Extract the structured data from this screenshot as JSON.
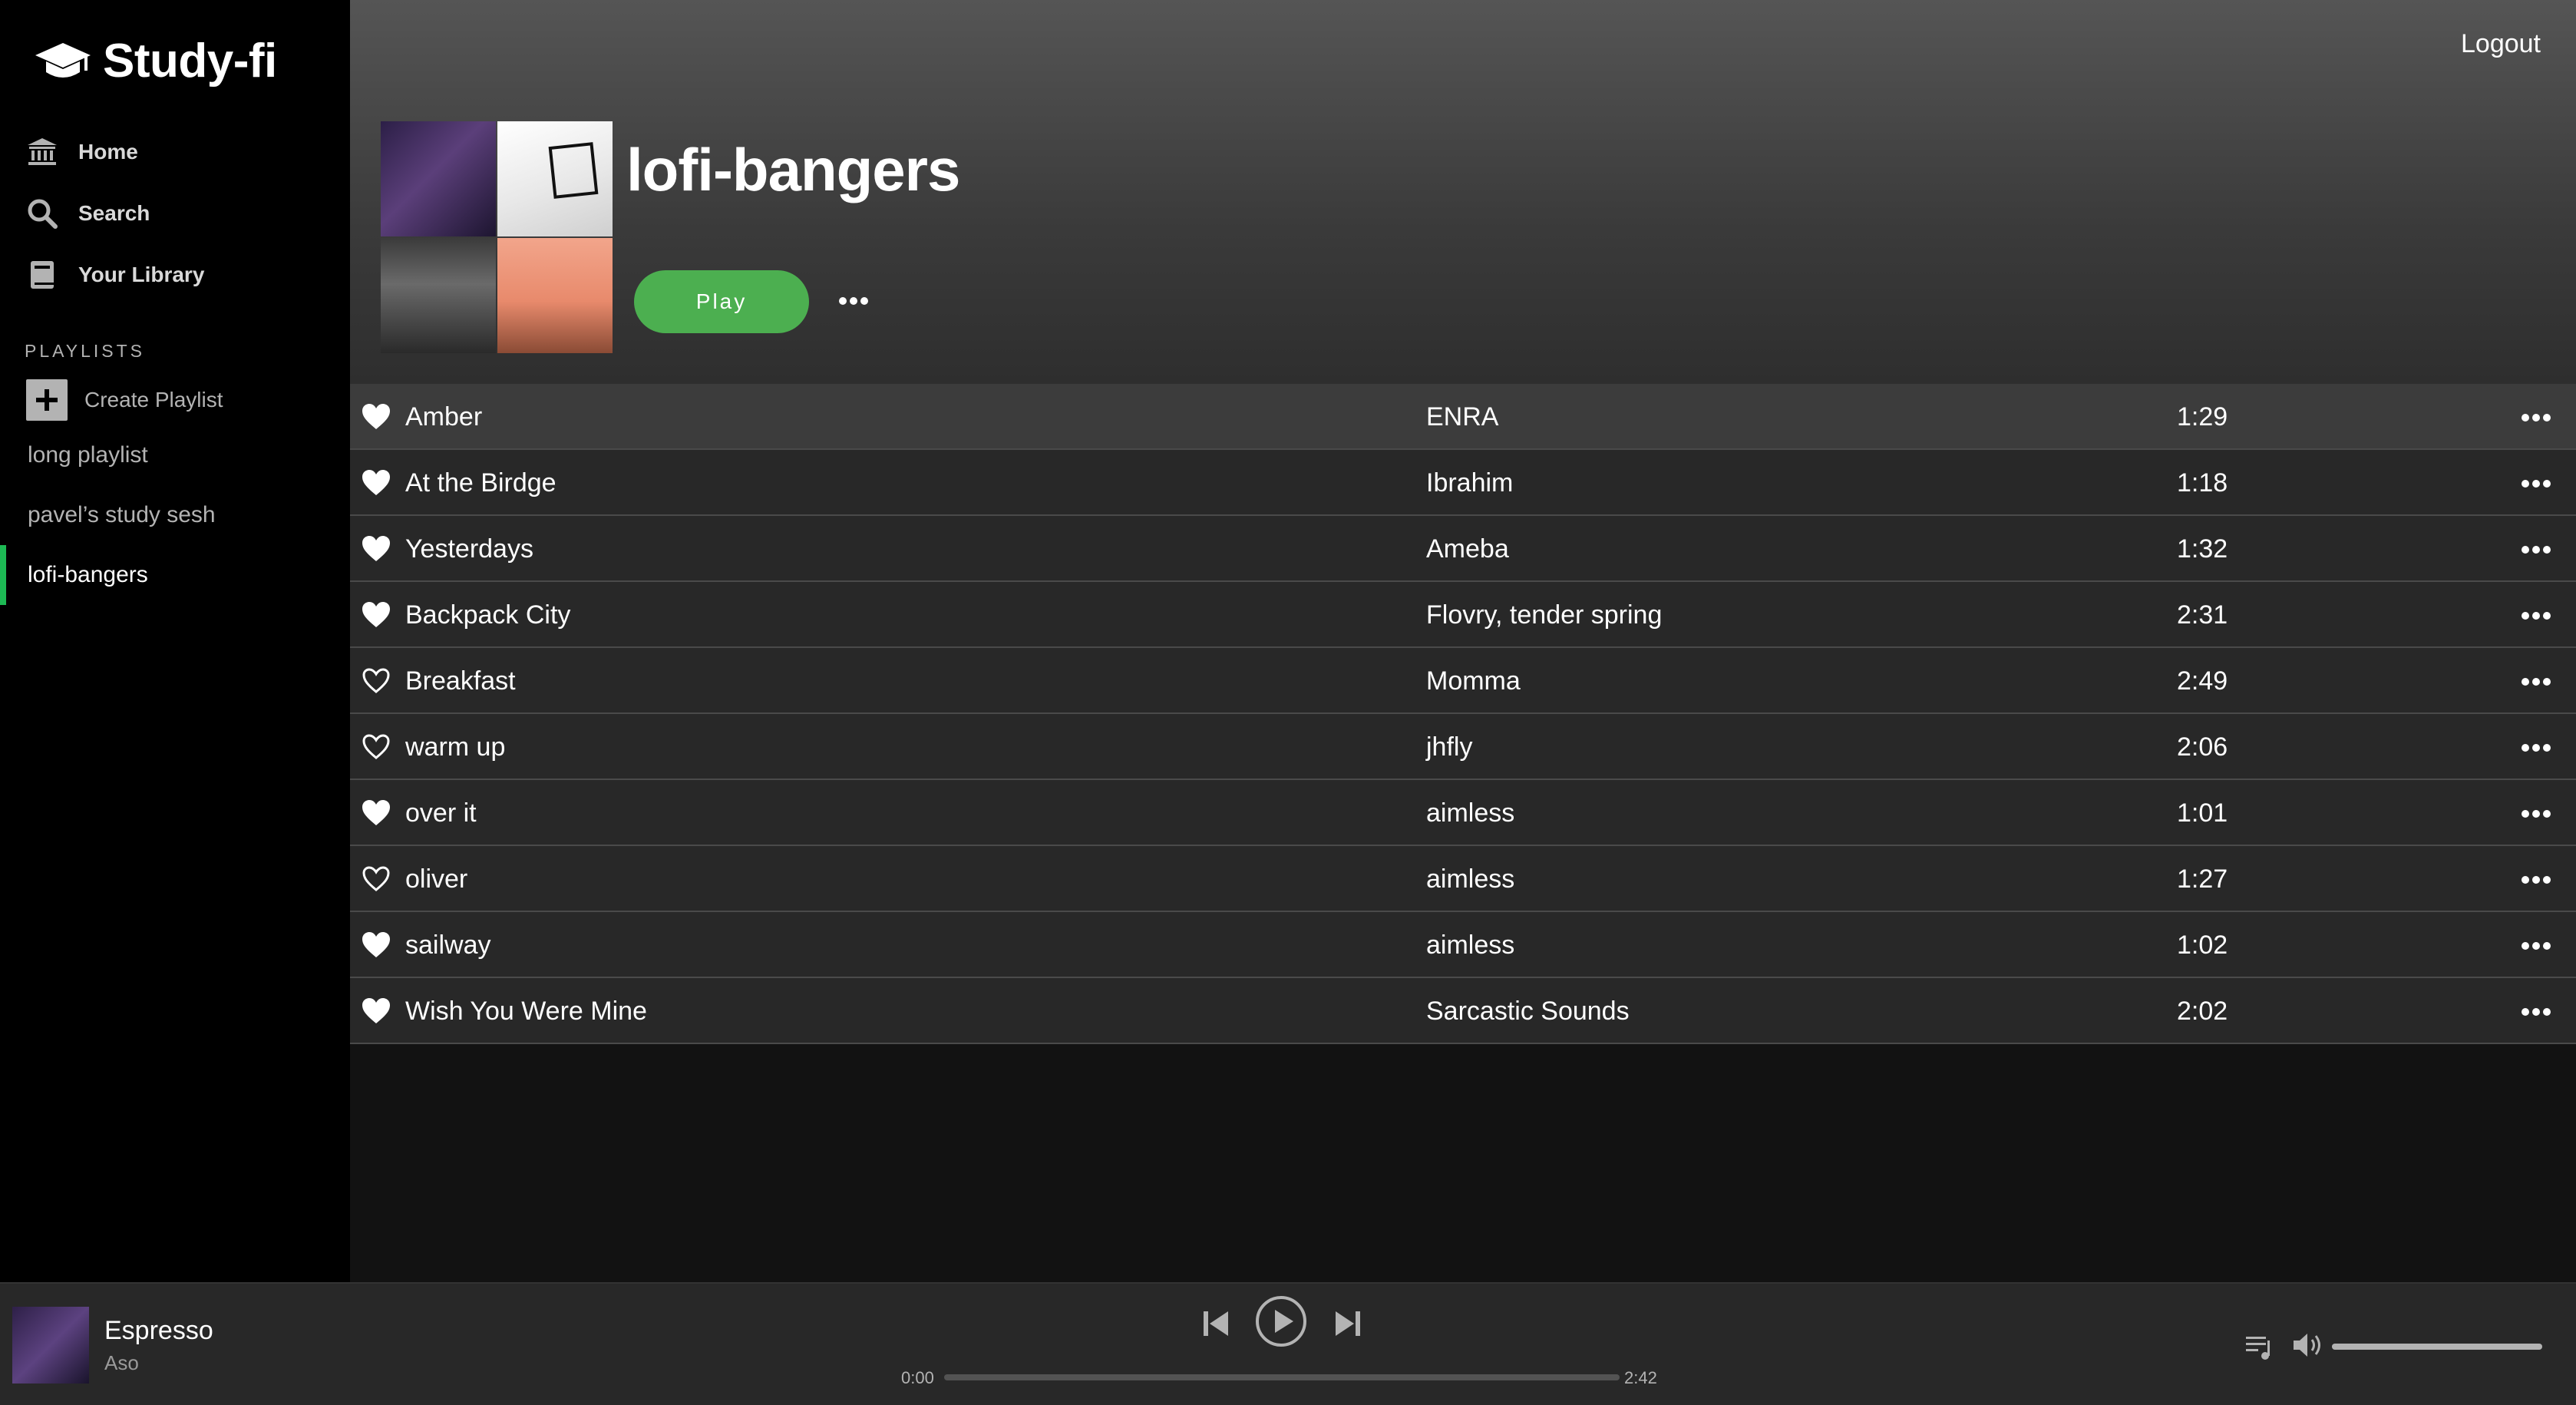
{
  "brand": {
    "name": "Study-fi",
    "icon": "graduation-cap-icon"
  },
  "nav": [
    {
      "label": "Home",
      "icon": "bank-icon"
    },
    {
      "label": "Search",
      "icon": "search-icon"
    },
    {
      "label": "Your Library",
      "icon": "book-icon"
    }
  ],
  "sidebar": {
    "playlists_heading": "PLAYLISTS",
    "create_playlist": "Create Playlist",
    "playlists": [
      "long playlist",
      "pavel’s study sesh",
      "lofi-bangers"
    ],
    "active_playlist": "lofi-bangers"
  },
  "header": {
    "logout": "Logout",
    "title": "lofi-bangers",
    "play_label": "Play"
  },
  "tracks": [
    {
      "title": "Amber",
      "artist": "ENRA",
      "duration": "1:29",
      "liked": true
    },
    {
      "title": "At the Birdge",
      "artist": "Ibrahim",
      "duration": "1:18",
      "liked": true
    },
    {
      "title": "Yesterdays",
      "artist": "Ameba",
      "duration": "1:32",
      "liked": true
    },
    {
      "title": "Backpack City",
      "artist": "Flovry, tender spring",
      "duration": "2:31",
      "liked": true
    },
    {
      "title": "Breakfast",
      "artist": "Momma",
      "duration": "2:49",
      "liked": false
    },
    {
      "title": "warm up",
      "artist": "jhfly",
      "duration": "2:06",
      "liked": false
    },
    {
      "title": "over it",
      "artist": "aimless",
      "duration": "1:01",
      "liked": true
    },
    {
      "title": "oliver",
      "artist": "aimless",
      "duration": "1:27",
      "liked": false
    },
    {
      "title": "sailway",
      "artist": "aimless",
      "duration": "1:02",
      "liked": true
    },
    {
      "title": "Wish You Were Mine",
      "artist": "Sarcastic Sounds",
      "duration": "2:02",
      "liked": true
    }
  ],
  "player": {
    "title": "Espresso",
    "artist": "Aso",
    "time_current": "0:00",
    "time_total": "2:42",
    "progress": 0,
    "volume": 1.0
  },
  "colors": {
    "accent": "#4caf50",
    "active_indicator": "#1db954",
    "sidebar_bg": "#000000",
    "main_bg": "#121212",
    "row_bg": "#282828"
  }
}
